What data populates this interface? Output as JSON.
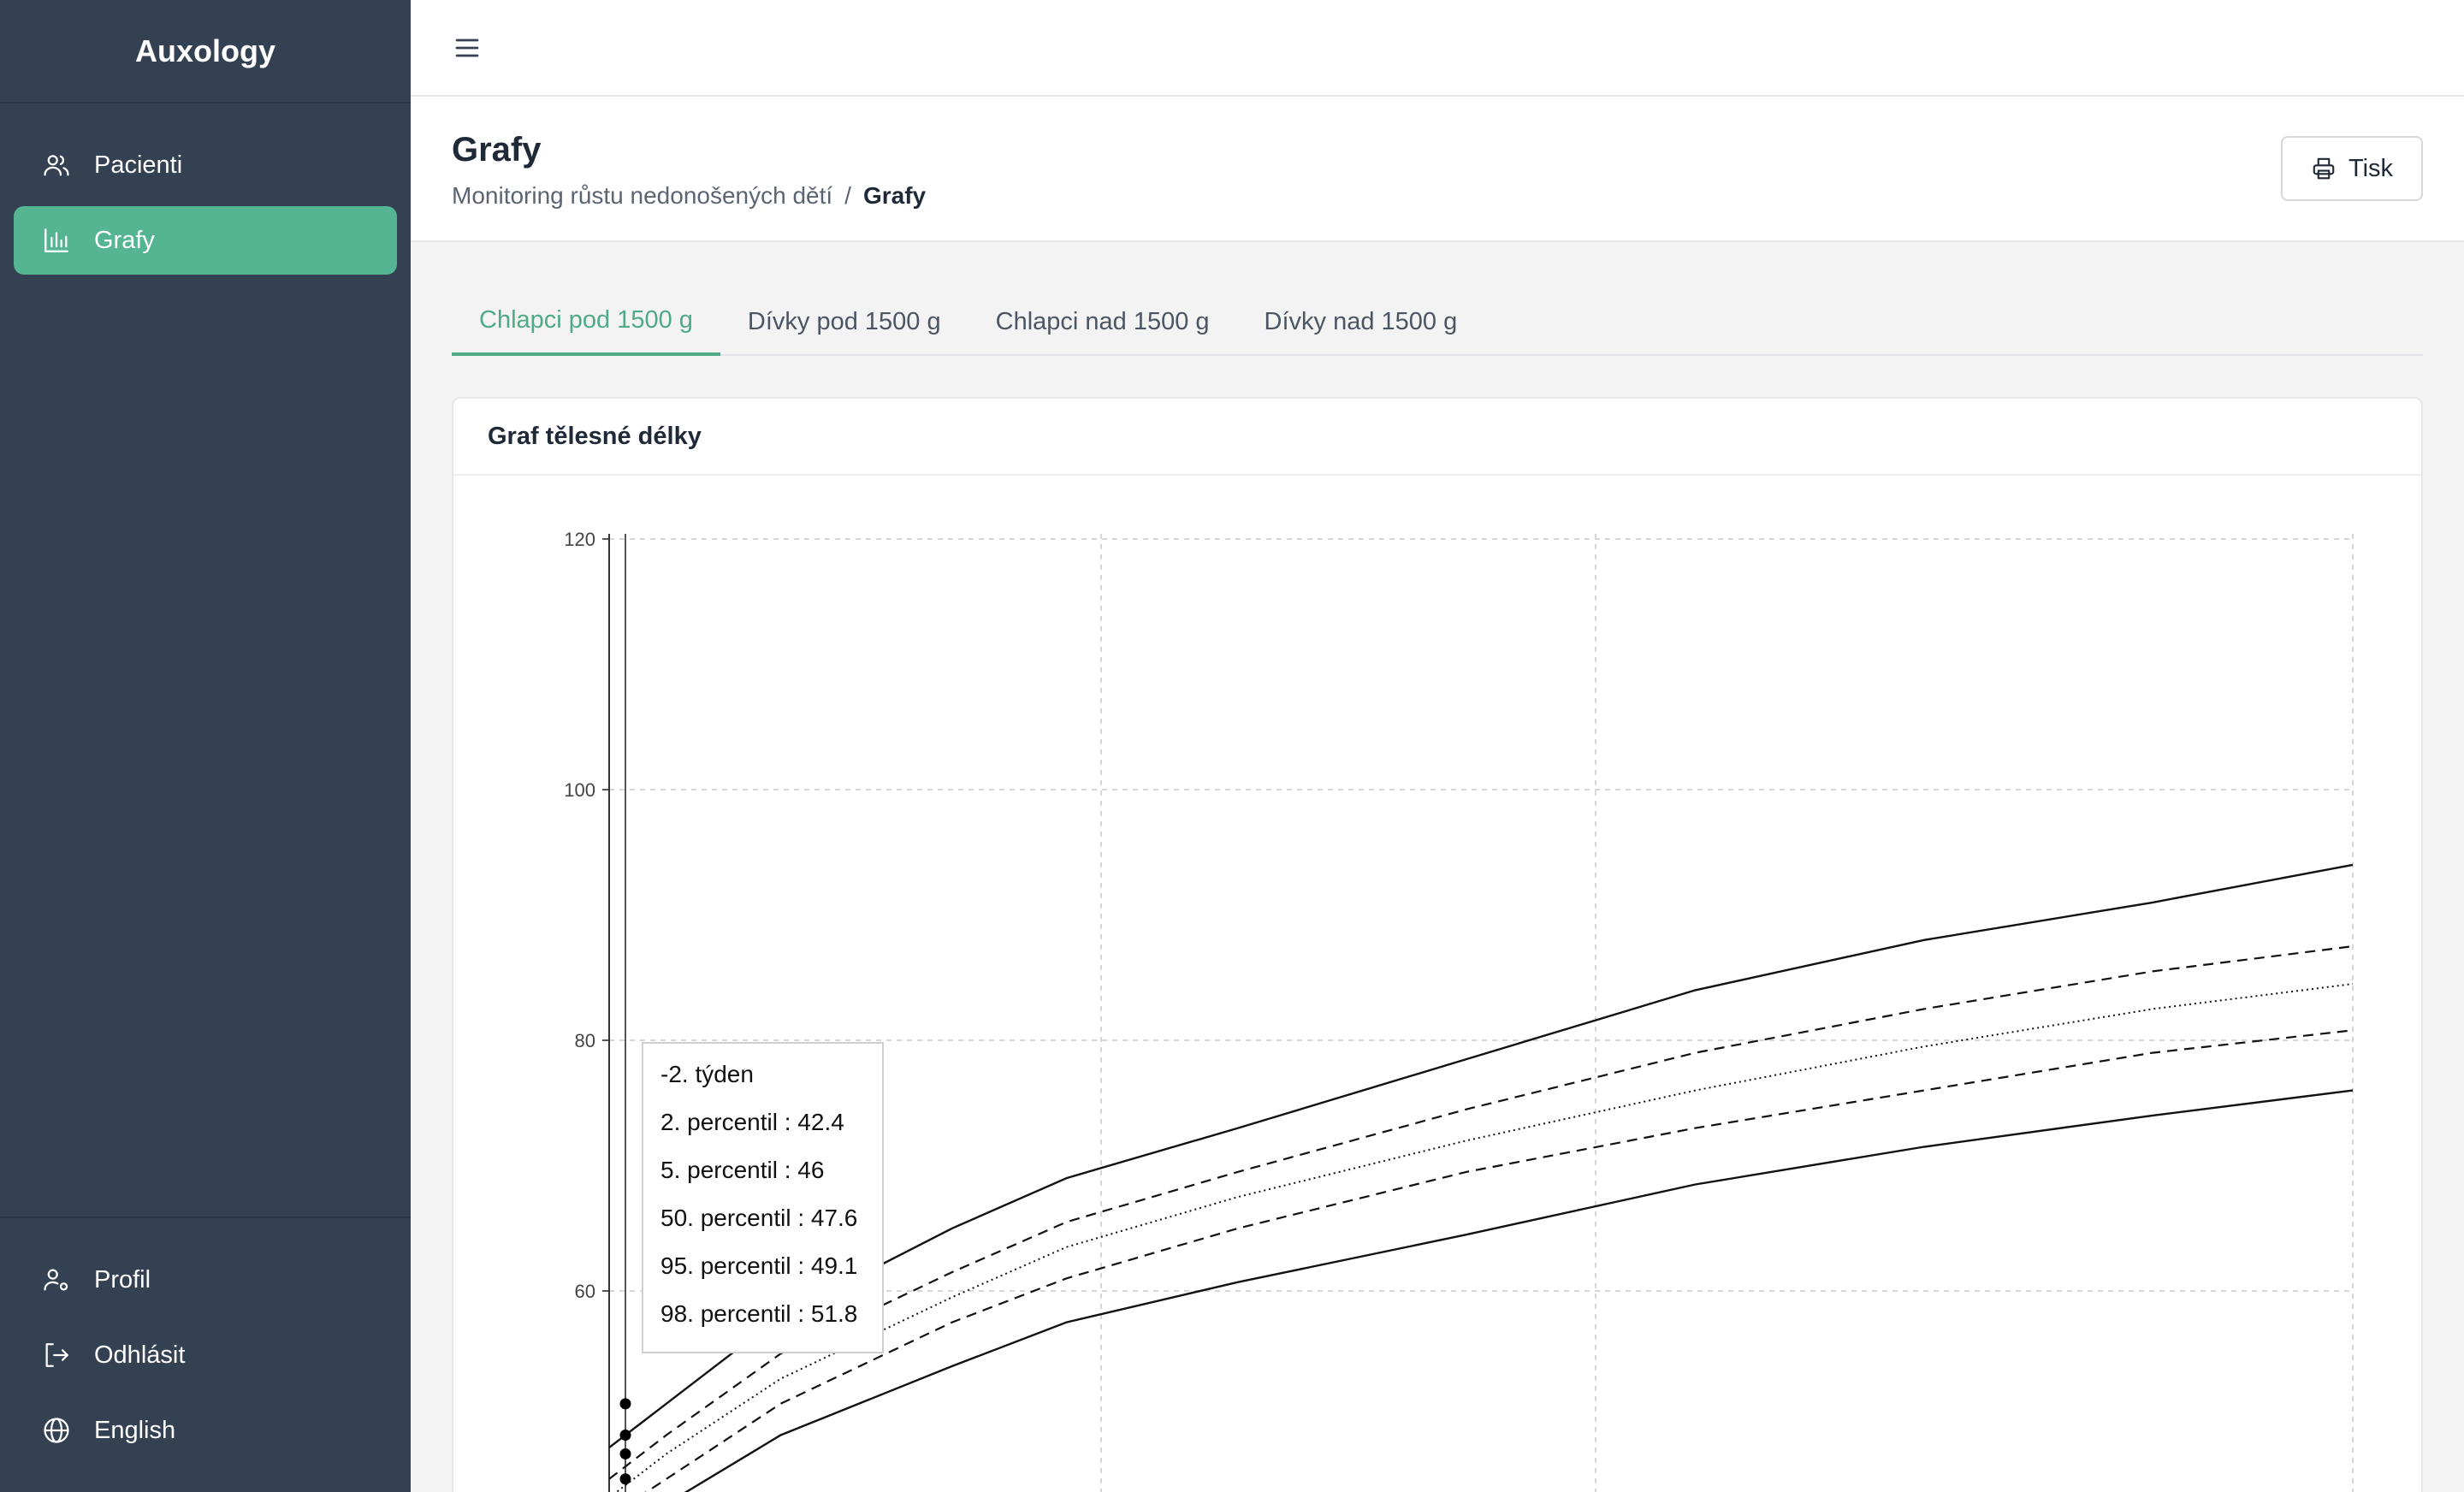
{
  "app": {
    "name": "Auxology"
  },
  "sidebar": {
    "items": [
      {
        "label": "Pacienti",
        "icon": "users-icon"
      },
      {
        "label": "Grafy",
        "icon": "bar-chart-icon",
        "active": true
      }
    ],
    "bottom_items": [
      {
        "label": "Profil",
        "icon": "user-settings-icon"
      },
      {
        "label": "Odhlásit",
        "icon": "logout-icon"
      },
      {
        "label": "English",
        "icon": "globe-icon"
      }
    ]
  },
  "header": {
    "title": "Grafy",
    "breadcrumb": [
      "Monitoring růstu nedonošených dětí",
      "/",
      "Grafy"
    ],
    "print_label": "Tisk"
  },
  "tabs": [
    {
      "label": "Chlapci pod 1500 g",
      "active": true
    },
    {
      "label": "Dívky pod 1500 g"
    },
    {
      "label": "Chlapci nad 1500 g"
    },
    {
      "label": "Dívky nad 1500 g"
    }
  ],
  "card": {
    "title": "Graf tělesné délky"
  },
  "tooltip": {
    "title": "-2. týden",
    "rows": [
      "2. percentil : 42.4",
      "5. percentil : 46",
      "50. percentil : 47.6",
      "95. percentil : 49.1",
      "98. percentil : 51.8"
    ]
  },
  "chart_data": {
    "type": "line",
    "title": "Graf tělesné délky",
    "y_ticks": [
      60,
      80,
      100,
      120
    ],
    "ylim": [
      40,
      120
    ],
    "grid": true,
    "series": [
      {
        "name": "2. percentil",
        "style": "solid",
        "x": [
          -2,
          0,
          4,
          10,
          14,
          20,
          28,
          36,
          44,
          52,
          59
        ],
        "values": [
          40,
          43,
          48.5,
          54,
          57.5,
          60.7,
          64.5,
          68.5,
          71.5,
          74,
          76
        ]
      },
      {
        "name": "5. percentil",
        "style": "dashed",
        "x": [
          -2,
          0,
          4,
          10,
          14,
          20,
          28,
          36,
          44,
          52,
          59
        ],
        "values": [
          42,
          45,
          51,
          57.5,
          61,
          65,
          69.5,
          73,
          76,
          79,
          80.8
        ]
      },
      {
        "name": "50. percentil",
        "style": "dotted",
        "x": [
          -2,
          0,
          4,
          10,
          14,
          20,
          28,
          36,
          44,
          52,
          59
        ],
        "values": [
          43.5,
          47,
          53,
          59.5,
          63.5,
          67.5,
          72,
          76,
          79.5,
          82.5,
          84.5
        ]
      },
      {
        "name": "95. percentil",
        "style": "dashed",
        "x": [
          -2,
          0,
          4,
          10,
          14,
          20,
          28,
          36,
          44,
          52,
          59
        ],
        "values": [
          45,
          48.5,
          55,
          61.5,
          65.5,
          69.5,
          74.5,
          79,
          82.5,
          85.5,
          87.5
        ]
      },
      {
        "name": "98. percentil",
        "style": "solid",
        "x": [
          -2,
          0,
          4,
          10,
          14,
          20,
          28,
          36,
          44,
          52,
          59
        ],
        "values": [
          47.5,
          51,
          58,
          65,
          69,
          73,
          78.5,
          84,
          88,
          91,
          94
        ]
      }
    ]
  }
}
